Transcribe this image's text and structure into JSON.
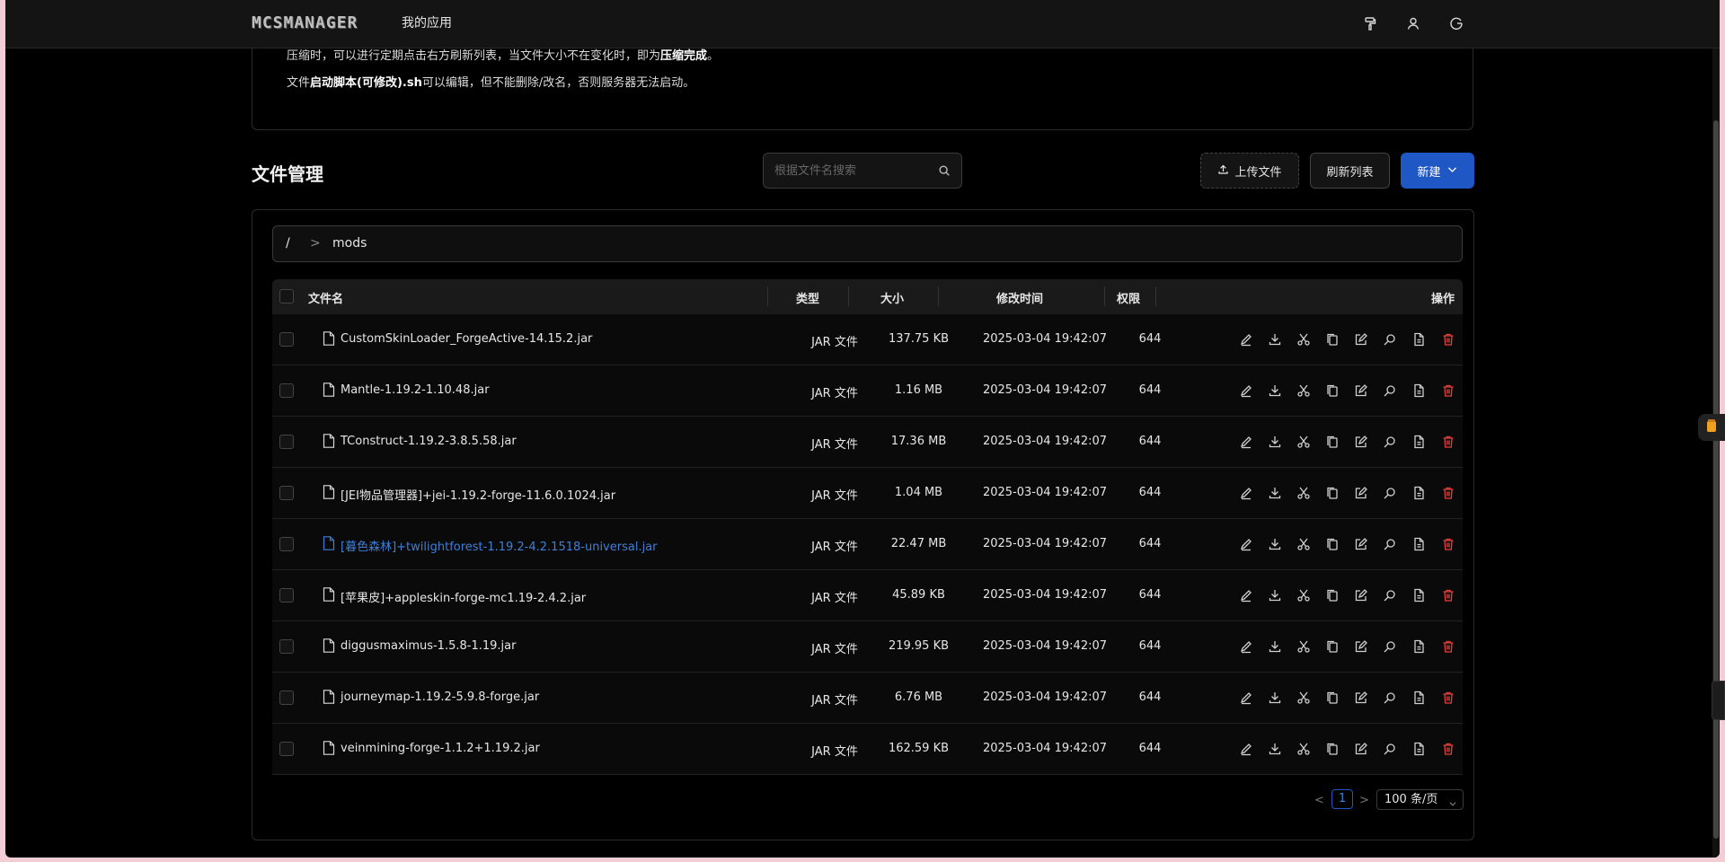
{
  "header": {
    "logo": "MCSMANAGER",
    "nav_apps": "我的应用",
    "icons": [
      "paint-roller-icon",
      "user-icon",
      "logout-icon"
    ]
  },
  "notice": {
    "line1_a": "压缩时，可以进行定期点击右方刷新列表，当文件大小不在变化时，即为",
    "line1_b": "压缩完成",
    "line1_c": "。",
    "line2_a": "文件",
    "line2_b": "启动脚本(可修改).sh",
    "line2_c": "可以编辑，但不能删除/改名，否则服务器无法启动。"
  },
  "toolbar": {
    "title": "文件管理",
    "search_placeholder": "根据文件名搜索",
    "upload_label": "上传文件",
    "refresh_label": "刷新列表",
    "new_label": "新建"
  },
  "breadcrumb": {
    "root": "/",
    "separator": ">",
    "current": "mods"
  },
  "table": {
    "columns": {
      "name": "文件名",
      "type": "类型",
      "size": "大小",
      "time": "修改时间",
      "perm": "权限",
      "actions": "操作"
    },
    "rows": [
      {
        "name": "CustomSkinLoader_ForgeActive-14.15.2.jar",
        "type": "JAR 文件",
        "size": "137.75 KB",
        "time": "2025-03-04 19:42:07",
        "perm": "644",
        "highlight": false
      },
      {
        "name": "Mantle-1.19.2-1.10.48.jar",
        "type": "JAR 文件",
        "size": "1.16 MB",
        "time": "2025-03-04 19:42:07",
        "perm": "644",
        "highlight": false
      },
      {
        "name": "TConstruct-1.19.2-3.8.5.58.jar",
        "type": "JAR 文件",
        "size": "17.36 MB",
        "time": "2025-03-04 19:42:07",
        "perm": "644",
        "highlight": false
      },
      {
        "name": "[JEI物品管理器]+jei-1.19.2-forge-11.6.0.1024.jar",
        "type": "JAR 文件",
        "size": "1.04 MB",
        "time": "2025-03-04 19:42:07",
        "perm": "644",
        "highlight": false
      },
      {
        "name": "[暮色森林]+twilightforest-1.19.2-4.2.1518-universal.jar",
        "type": "JAR 文件",
        "size": "22.47 MB",
        "time": "2025-03-04 19:42:07",
        "perm": "644",
        "highlight": true
      },
      {
        "name": "[苹果皮]+appleskin-forge-mc1.19-2.4.2.jar",
        "type": "JAR 文件",
        "size": "45.89 KB",
        "time": "2025-03-04 19:42:07",
        "perm": "644",
        "highlight": false
      },
      {
        "name": "diggusmaximus-1.5.8-1.19.jar",
        "type": "JAR 文件",
        "size": "219.95 KB",
        "time": "2025-03-04 19:42:07",
        "perm": "644",
        "highlight": false
      },
      {
        "name": "journeymap-1.19.2-5.9.8-forge.jar",
        "type": "JAR 文件",
        "size": "6.76 MB",
        "time": "2025-03-04 19:42:07",
        "perm": "644",
        "highlight": false
      },
      {
        "name": "veinmining-forge-1.1.2+1.19.2.jar",
        "type": "JAR 文件",
        "size": "162.59 KB",
        "time": "2025-03-04 19:42:07",
        "perm": "644",
        "highlight": false
      }
    ],
    "row_actions": [
      "edit-icon",
      "download-icon",
      "cut-icon",
      "copy-icon",
      "rename-icon",
      "search-icon",
      "file-info-icon",
      "delete-icon"
    ]
  },
  "pagination": {
    "prev": "<",
    "current": "1",
    "next": ">",
    "page_size": "100 条/页"
  },
  "colors": {
    "accent": "#1f57c4",
    "link": "#3f7fd8",
    "danger": "#e3413b",
    "background": "#000000"
  }
}
